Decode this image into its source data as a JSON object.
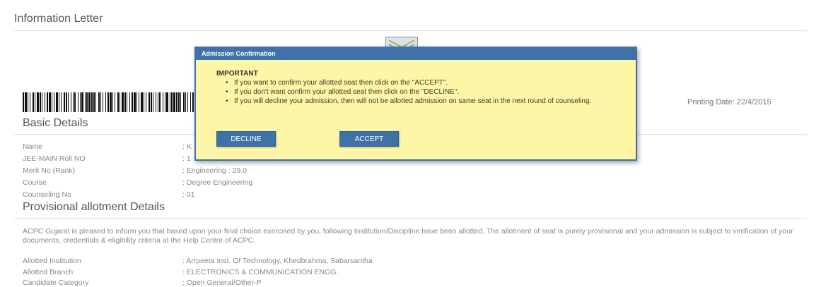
{
  "page_title": "Information Letter",
  "printing_date": "Printing Date: 22/4/2015",
  "basic_details": {
    "heading": "Basic Details",
    "rows": [
      {
        "label": "Name",
        "value": ": K"
      },
      {
        "label": "JEE-MAIN Roll NO",
        "value": ": 1"
      },
      {
        "label": "Merit No (Rank)",
        "value": ": Engineering : 29.0"
      },
      {
        "label": "Course",
        "value": ": Degree Engineering"
      },
      {
        "label": "Counseling No",
        "value": ": 01"
      }
    ]
  },
  "allotment": {
    "heading": "Provisional allotment Details",
    "intro": "ACPC Gujarat is pleased to inform you that based upon your final choice exercised by you, following Institution/Discipline have been allotted. The allotment of seat is purely provisional and your admission is subject to verification of your documents, credentials & eligibility criteria at the Help Centre of ACPC.",
    "rows": [
      {
        "label": "Allotted Institution",
        "value": ": Arrpeeta Inst. Of Technology, Khedbrahma, Sabarsantha"
      },
      {
        "label": "Allotted Branch",
        "value": ": ELECTRONICS & COMMUNICATION ENGG."
      },
      {
        "label": "Candidate Category",
        "value": ": Open General/Other-P"
      }
    ]
  },
  "modal": {
    "title": "Admission Confirmation",
    "important_label": "IMPORTANT",
    "items": [
      "If you want to confirm your allotted seat then click on the \"ACCEPT\".",
      "If you don't want confirm your allotted seat then click on the \"DECLINE\".",
      "If you will decline your admission, then will not be allotted admission on same seat in the next round of counseling."
    ],
    "decline_label": "DECLINE",
    "accept_label": "ACCEPT"
  },
  "colors": {
    "modal_bg": "#fdf6a7",
    "modal_accent": "#3f72a8"
  },
  "icons": {
    "logo": "institution-logo",
    "barcode": "barcode"
  }
}
